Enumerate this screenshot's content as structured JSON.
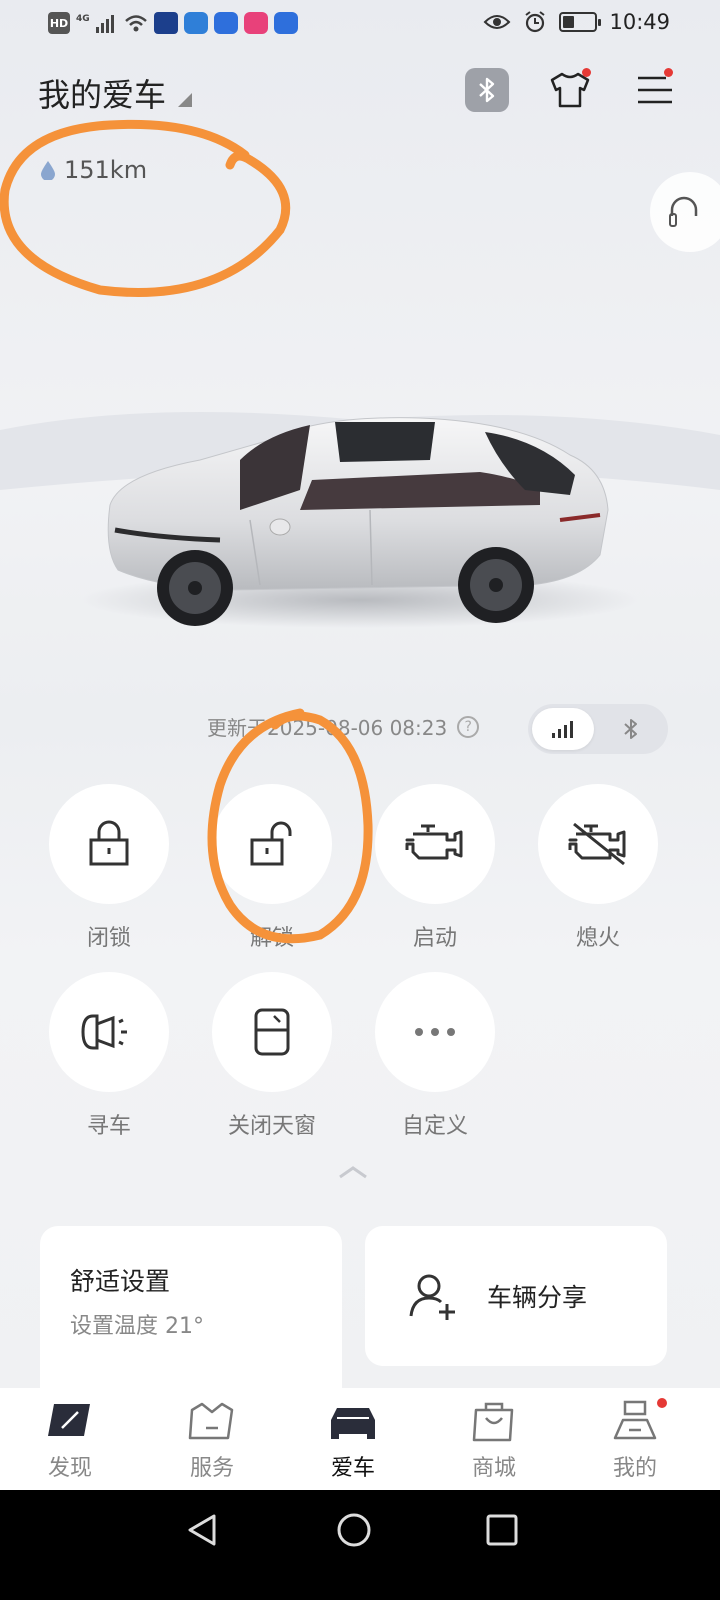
{
  "status_bar": {
    "left_chips": [
      "HD",
      "4G"
    ],
    "time": "10:49",
    "battery_level": 0.35
  },
  "header": {
    "title": "我的爱车"
  },
  "range": {
    "value": "151km"
  },
  "update": {
    "text": "更新于2025-08-06 08:23"
  },
  "connection_toggle": {
    "options": [
      "cellular-signal-icon",
      "bluetooth-icon"
    ],
    "selected": "cellular-signal-icon"
  },
  "controls": [
    {
      "label": "闭锁",
      "icon": "lock-icon"
    },
    {
      "label": "解锁",
      "icon": "unlock-icon"
    },
    {
      "label": "启动",
      "icon": "engine-icon"
    },
    {
      "label": "熄火",
      "icon": "engine-off-icon"
    },
    {
      "label": "寻车",
      "icon": "horn-icon"
    },
    {
      "label": "关闭天窗",
      "icon": "sunroof-icon"
    },
    {
      "label": "自定义",
      "icon": "more-icon"
    }
  ],
  "comfort_card": {
    "title": "舒适设置",
    "subtitle": "设置温度 21°"
  },
  "share_card": {
    "label": "车辆分享"
  },
  "tabs": [
    {
      "label": "发现",
      "icon": "compass-icon"
    },
    {
      "label": "服务",
      "icon": "service-icon"
    },
    {
      "label": "爱车",
      "icon": "car-icon",
      "active": true
    },
    {
      "label": "商城",
      "icon": "shopping-bag-icon"
    },
    {
      "label": "我的",
      "icon": "profile-icon"
    }
  ],
  "colors": {
    "annotation": "#f5923a",
    "notification_dot": "#e53935",
    "car_body": "#e4e5e8"
  }
}
